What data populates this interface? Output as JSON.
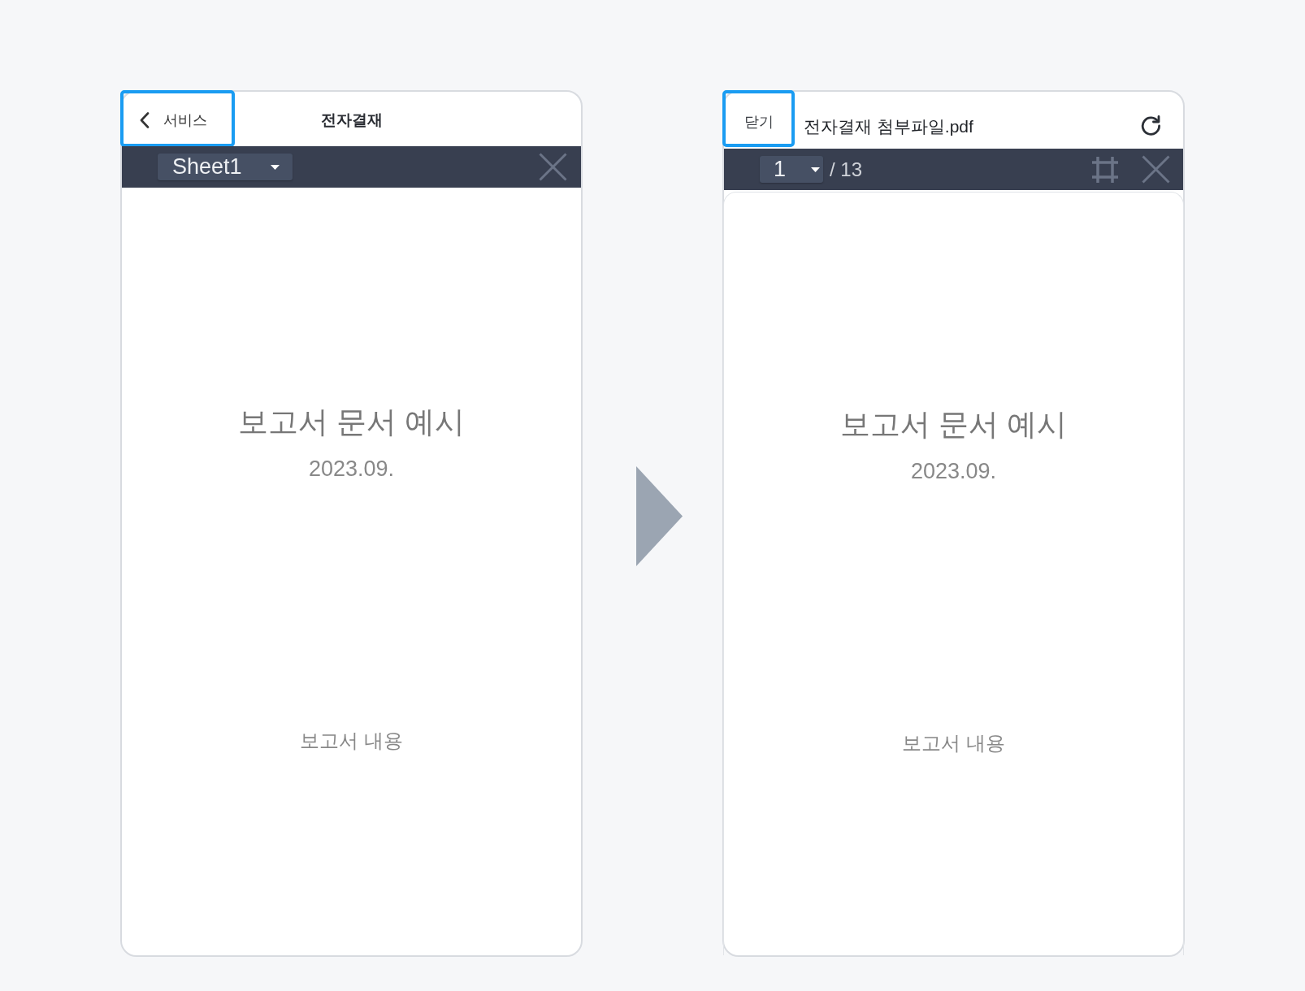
{
  "screens": [
    {
      "kind": "sheet_viewer",
      "header": {
        "button": {
          "kind": "back",
          "label": "서비스",
          "highlighted": true
        },
        "title": "전자결재"
      },
      "toolbar": {
        "selector": "Sheet1"
      },
      "document": {
        "title": "보고서 문서 예시",
        "date": "2023.09.",
        "body": "보고서 내용"
      }
    },
    {
      "kind": "pdf_viewer",
      "header": {
        "button": {
          "kind": "close",
          "label": "닫기",
          "highlighted": true
        },
        "title": "전자결재 첨부파일.pdf"
      },
      "toolbar": {
        "selector": "1",
        "page_count": "/ 13"
      },
      "document": {
        "title": "보고서 문서 예시",
        "date": "2023.09.",
        "body": "보고서 내용"
      }
    }
  ]
}
